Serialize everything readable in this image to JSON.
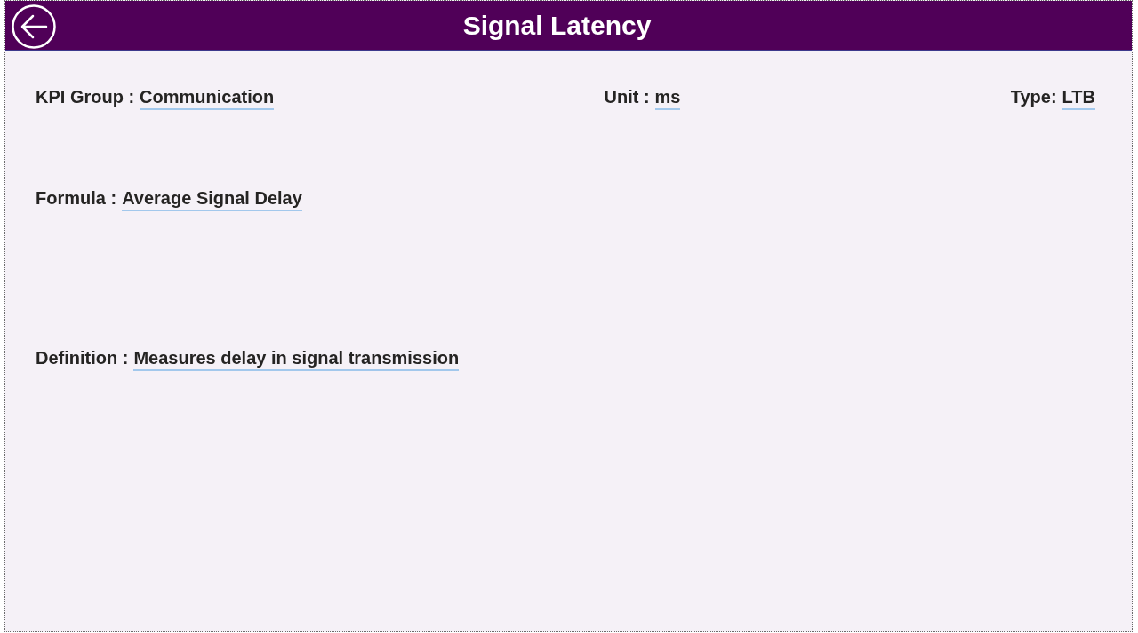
{
  "header": {
    "title": "Signal Latency"
  },
  "rows": [
    {
      "fields": [
        {
          "label": "KPI Group :",
          "value": "Communication"
        },
        {
          "label": "Unit :",
          "value": "ms"
        },
        {
          "label": "Type:",
          "value": "LTB"
        }
      ]
    },
    {
      "fields": [
        {
          "label": "Formula :",
          "value": "Average Signal Delay"
        }
      ]
    },
    {
      "fields": [
        {
          "label": "Definition :",
          "value": "Measures delay in signal transmission"
        }
      ]
    }
  ]
}
